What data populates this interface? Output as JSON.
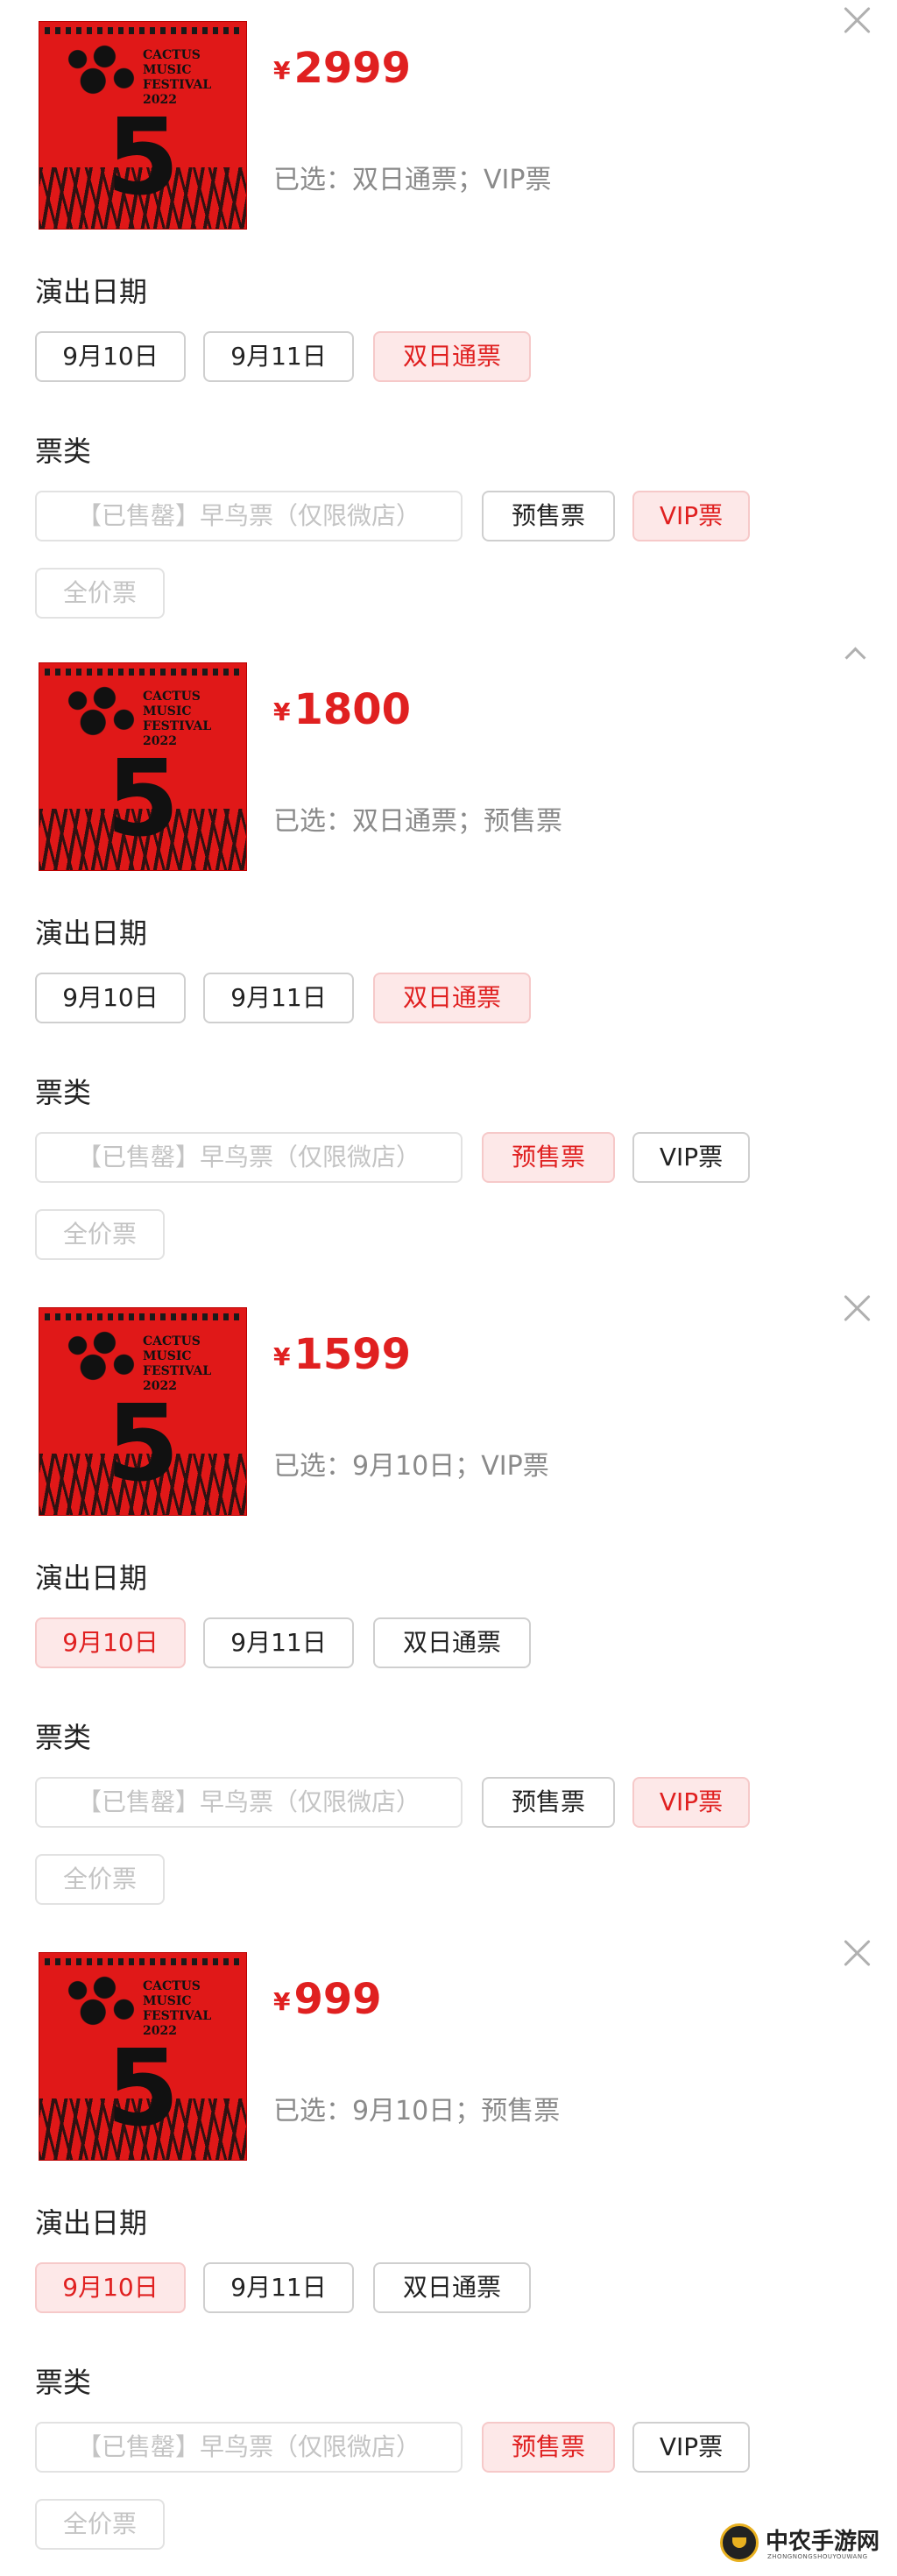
{
  "poster_text": "CACTUS\nMUSIC\nFESTIVAL\n2022",
  "poster_number": "5",
  "labels": {
    "date": "演出日期",
    "type": "票类"
  },
  "date_options": [
    "9月10日",
    "9月11日",
    "双日通票"
  ],
  "type_options": [
    "【已售罄】早鸟票（仅限微店）",
    "预售票",
    "VIP票",
    "全价票"
  ],
  "panels": [
    {
      "yen": "¥",
      "price": "2999",
      "selected": "已选：双日通票；VIP票",
      "header_icon": "close-icon"
    },
    {
      "yen": "¥",
      "price": "1800",
      "selected": "已选：双日通票；预售票",
      "header_icon": "chevron-up-icon"
    },
    {
      "yen": "¥",
      "price": "1599",
      "selected": "已选：9月10日；VIP票",
      "header_icon": "close-icon"
    },
    {
      "yen": "¥",
      "price": "999",
      "selected": "已选：9月10日；预售票",
      "header_icon": "close-icon"
    }
  ],
  "watermark": {
    "title": "中农手游网",
    "subtitle": "ZHONGNONGSHOUYOUWANG"
  },
  "colors": {
    "accent": "#e02020",
    "active_bg": "#fde8e8",
    "poster_red": "#e01818"
  }
}
